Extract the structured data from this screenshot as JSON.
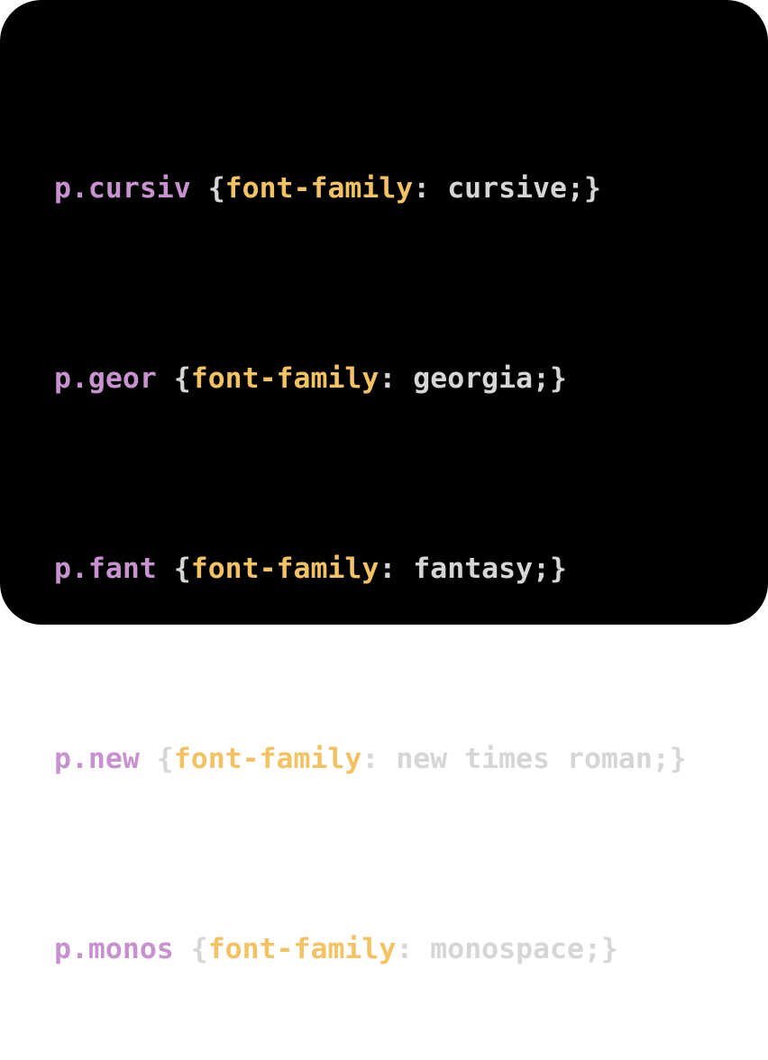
{
  "colors": {
    "background": "#000000",
    "selector": "#c792cf",
    "property": "#f2c263",
    "text": "#d6d6d6"
  },
  "code": {
    "lines": [
      {
        "selector": "p.cursiv",
        "open": "{",
        "property": "font-family",
        "colon": ":",
        "value": "cursive;",
        "close": "}"
      },
      {
        "selector": "p.geor",
        "open": "{",
        "property": "font-family",
        "colon": ":",
        "value": "georgia;",
        "close": "}"
      },
      {
        "selector": "p.fant",
        "open": "{",
        "property": "font-family",
        "colon": ":",
        "value": "fantasy;",
        "close": "}"
      },
      {
        "selector": "p.new",
        "open": "{",
        "property": "font-family",
        "colon": ":",
        "value": "new times roman;",
        "close": "}"
      },
      {
        "selector": "p.monos",
        "open": "{",
        "property": "font-family",
        "colon": ":",
        "value": "monospace;",
        "close": "}"
      }
    ]
  }
}
